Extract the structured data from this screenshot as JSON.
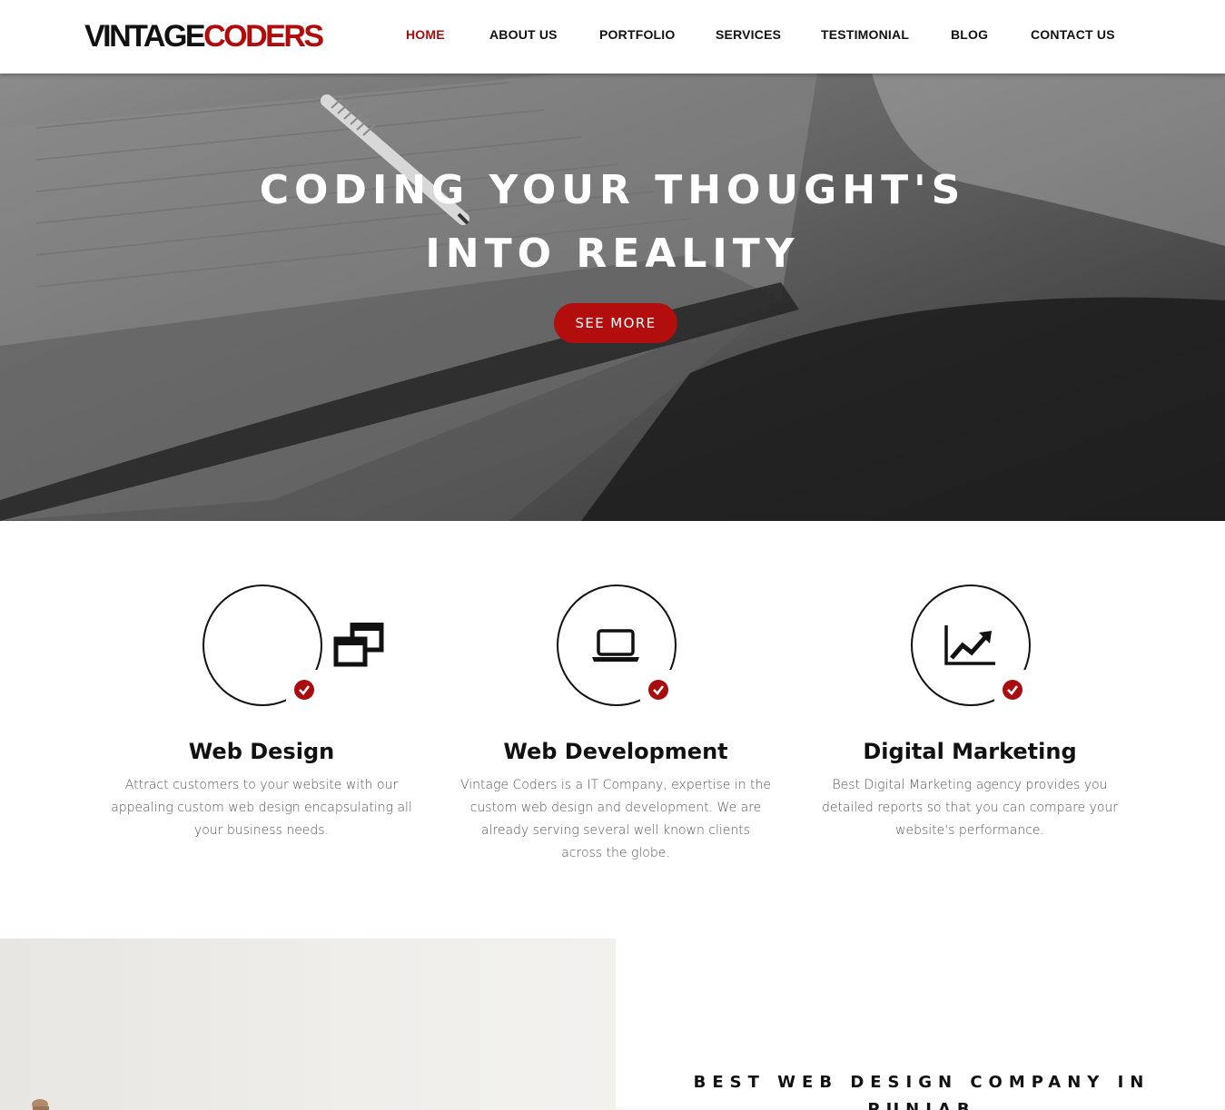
{
  "brand": {
    "logo_part1": "VINTAGE",
    "logo_part2": "CODERS",
    "accent_color": "#b10c0c"
  },
  "nav": {
    "items": [
      {
        "label": "HOME",
        "active": true
      },
      {
        "label": "ABOUT US",
        "active": false
      },
      {
        "label": "PORTFOLIO",
        "active": false
      },
      {
        "label": "SERVICES",
        "active": false
      },
      {
        "label": "TESTIMONIAL",
        "active": false
      },
      {
        "label": "BLOG",
        "active": false
      },
      {
        "label": "CONTACT US",
        "active": false
      }
    ]
  },
  "hero": {
    "title_line1": "CODING YOUR THOUGHT'S",
    "title_line2": "INTO REALITY",
    "button_label": "SEE MORE"
  },
  "services": [
    {
      "icon": "windows-stack-icon",
      "title": "Web Design",
      "text": "Attract customers to your website with our appealing custom web design encapsulating all your business needs."
    },
    {
      "icon": "laptop-icon",
      "title": "Web Development",
      "text": "Vintage Coders is a IT Company, expertise in the custom web design and development. We are already serving several well known clients across the globe."
    },
    {
      "icon": "line-chart-icon",
      "title": "Digital Marketing",
      "text": "Best Digital Marketing agency provides you detailed reports so that you can compare your website's performance."
    }
  ],
  "about": {
    "heading": "BEST WEB DESIGN COMPANY IN PUNJAB"
  }
}
